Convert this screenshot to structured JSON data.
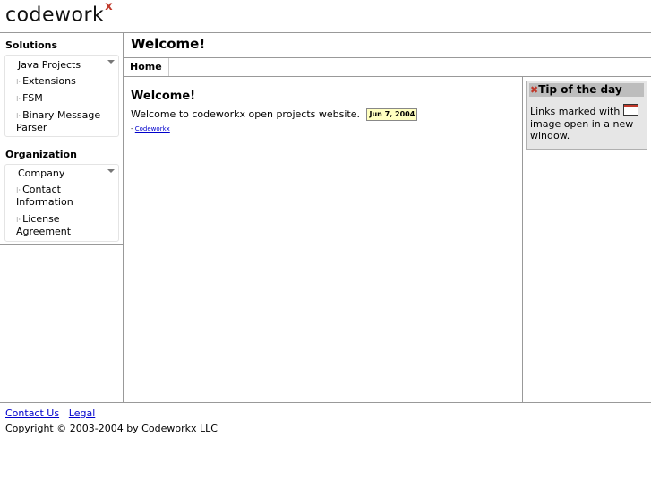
{
  "brand": {
    "name": "codework",
    "mark": "x"
  },
  "sidebar": {
    "sections": [
      {
        "title": "Solutions",
        "group": "Java Projects",
        "items": [
          "Extensions",
          "FSM",
          "Binary Message Parser"
        ]
      },
      {
        "title": "Organization",
        "group": "Company",
        "items": [
          "Contact Information",
          "License Agreement"
        ]
      }
    ]
  },
  "main": {
    "page_title": "Welcome!",
    "tab": "Home",
    "heading": "Welcome!",
    "welcome_text": "Welcome to codeworkx open projects website.",
    "date": "Jun 7, 2004",
    "link_prefix": "- ",
    "link_text": "Codeworkx"
  },
  "tip": {
    "title": "Tip of the day",
    "text_before": "Links marked with",
    "text_after": "image open in a new window."
  },
  "footer": {
    "contact": "Contact Us",
    "separator": "|",
    "legal": "Legal",
    "copyright": "Copyright © 2003-2004 by Codeworkx LLC"
  },
  "colors": {
    "accent": "#c0392b",
    "link": "#0000cc",
    "date_bg": "#ffffc0",
    "tip_bg": "#e6e6e6",
    "tip_head": "#bdbdbd"
  },
  "icons": [
    "close-x-icon",
    "new-window-icon",
    "chevron-down-icon",
    "bullet-icon"
  ]
}
